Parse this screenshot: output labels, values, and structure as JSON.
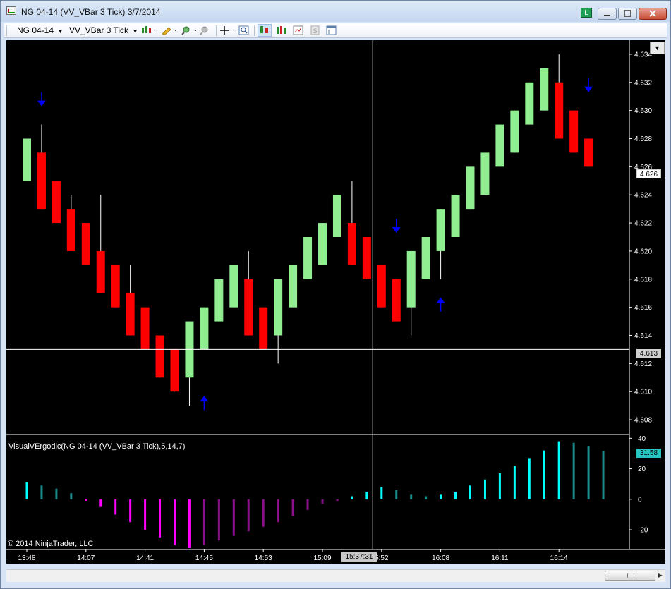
{
  "window": {
    "title": "NG 04-14 (VV_VBar 3 Tick)  3/7/2014",
    "lock_label": "L",
    "minimize_icon": "minimize-icon",
    "maximize_icon": "maximize-icon",
    "close_icon": "close-icon"
  },
  "toolbar": {
    "instrument": "NG 04-14",
    "bar_type": "VV_VBar 3 Tick",
    "icons": [
      "candlestick-style-icon",
      "pencil-draw-icon",
      "zoom-in-icon",
      "zoom-out-icon",
      "crosshair-icon",
      "magnifier-icon",
      "strategy-icon",
      "indicator-icon",
      "properties-icon",
      "dollar-icon",
      "data-box-icon"
    ]
  },
  "chart": {
    "dropdown_icon": "chevron-down-icon",
    "indicator_label": "VisualVErgodic(NG 04-14 (VV_VBar 3 Tick),5,14,7)",
    "copyright": "© 2014 NinjaTrader, LLC",
    "last_price_tag": "4.626",
    "crosshair_price_tag": "4.613",
    "indicator_value_tag": "31.58",
    "crosshair_time_tag": "15:37:31",
    "colors": {
      "background": "#000000",
      "up": "#90ee90",
      "down": "#ff0000",
      "arrow": "#0000ff",
      "ind_pos": "#00ffff",
      "ind_neg": "#ff00ff"
    }
  },
  "chart_data": [
    {
      "type": "candlestick",
      "title": "",
      "ylim": [
        4.607,
        4.635
      ],
      "y_ticks": [
        4.608,
        4.61,
        4.612,
        4.614,
        4.616,
        4.618,
        4.62,
        4.622,
        4.624,
        4.626,
        4.628,
        4.63,
        4.632,
        4.634
      ],
      "x_ticks": [
        "13:48",
        "14:07",
        "14:41",
        "14:45",
        "14:53",
        "15:09",
        "5:52",
        "16:08",
        "16:11",
        "16:14"
      ],
      "x_tick_bar_index": [
        0,
        4,
        8,
        12,
        16,
        20,
        24,
        28,
        32,
        36
      ],
      "bars": [
        {
          "open": 4.625,
          "high": 4.628,
          "low": 4.625,
          "close": 4.628
        },
        {
          "open": 4.627,
          "high": 4.629,
          "low": 4.623,
          "close": 4.623
        },
        {
          "open": 4.625,
          "high": 4.625,
          "low": 4.622,
          "close": 4.622
        },
        {
          "open": 4.623,
          "high": 4.624,
          "low": 4.62,
          "close": 4.62
        },
        {
          "open": 4.622,
          "high": 4.622,
          "low": 4.619,
          "close": 4.619
        },
        {
          "open": 4.62,
          "high": 4.624,
          "low": 4.617,
          "close": 4.617
        },
        {
          "open": 4.619,
          "high": 4.619,
          "low": 4.616,
          "close": 4.616
        },
        {
          "open": 4.617,
          "high": 4.619,
          "low": 4.614,
          "close": 4.614
        },
        {
          "open": 4.616,
          "high": 4.616,
          "low": 4.613,
          "close": 4.613
        },
        {
          "open": 4.614,
          "high": 4.614,
          "low": 4.611,
          "close": 4.611
        },
        {
          "open": 4.613,
          "high": 4.613,
          "low": 4.61,
          "close": 4.61
        },
        {
          "open": 4.611,
          "high": 4.615,
          "low": 4.609,
          "close": 4.615
        },
        {
          "open": 4.613,
          "high": 4.616,
          "low": 4.613,
          "close": 4.616
        },
        {
          "open": 4.615,
          "high": 4.618,
          "low": 4.615,
          "close": 4.618
        },
        {
          "open": 4.616,
          "high": 4.619,
          "low": 4.616,
          "close": 4.619
        },
        {
          "open": 4.618,
          "high": 4.62,
          "low": 4.614,
          "close": 4.614
        },
        {
          "open": 4.616,
          "high": 4.616,
          "low": 4.613,
          "close": 4.613
        },
        {
          "open": 4.614,
          "high": 4.618,
          "low": 4.612,
          "close": 4.618
        },
        {
          "open": 4.616,
          "high": 4.619,
          "low": 4.616,
          "close": 4.619
        },
        {
          "open": 4.618,
          "high": 4.621,
          "low": 4.618,
          "close": 4.621
        },
        {
          "open": 4.619,
          "high": 4.622,
          "low": 4.619,
          "close": 4.622
        },
        {
          "open": 4.621,
          "high": 4.624,
          "low": 4.621,
          "close": 4.624
        },
        {
          "open": 4.622,
          "high": 4.625,
          "low": 4.619,
          "close": 4.619
        },
        {
          "open": 4.621,
          "high": 4.621,
          "low": 4.618,
          "close": 4.618
        },
        {
          "open": 4.619,
          "high": 4.619,
          "low": 4.616,
          "close": 4.616
        },
        {
          "open": 4.618,
          "high": 4.618,
          "low": 4.615,
          "close": 4.615
        },
        {
          "open": 4.616,
          "high": 4.62,
          "low": 4.614,
          "close": 4.62
        },
        {
          "open": 4.618,
          "high": 4.621,
          "low": 4.618,
          "close": 4.621
        },
        {
          "open": 4.62,
          "high": 4.623,
          "low": 4.618,
          "close": 4.623
        },
        {
          "open": 4.621,
          "high": 4.624,
          "low": 4.621,
          "close": 4.624
        },
        {
          "open": 4.623,
          "high": 4.626,
          "low": 4.623,
          "close": 4.626
        },
        {
          "open": 4.624,
          "high": 4.627,
          "low": 4.624,
          "close": 4.627
        },
        {
          "open": 4.626,
          "high": 4.629,
          "low": 4.626,
          "close": 4.629
        },
        {
          "open": 4.627,
          "high": 4.63,
          "low": 4.627,
          "close": 4.63
        },
        {
          "open": 4.629,
          "high": 4.632,
          "low": 4.629,
          "close": 4.632
        },
        {
          "open": 4.63,
          "high": 4.633,
          "low": 4.63,
          "close": 4.633
        },
        {
          "open": 4.632,
          "high": 4.634,
          "low": 4.628,
          "close": 4.628
        },
        {
          "open": 4.63,
          "high": 4.63,
          "low": 4.627,
          "close": 4.627
        },
        {
          "open": 4.628,
          "high": 4.628,
          "low": 4.626,
          "close": 4.626
        }
      ],
      "signals": [
        {
          "bar": 1,
          "direction": "down",
          "price": 4.6305
        },
        {
          "bar": 12,
          "direction": "up",
          "price": 4.6095
        },
        {
          "bar": 25,
          "direction": "down",
          "price": 4.6215
        },
        {
          "bar": 28,
          "direction": "up",
          "price": 4.6165
        },
        {
          "bar": 38,
          "direction": "down",
          "price": 4.6315
        }
      ],
      "crosshair": {
        "price": 4.613,
        "bar": 23.4
      }
    },
    {
      "type": "bar",
      "title": "VisualVErgodic(NG 04-14 (VV_VBar 3 Tick),5,14,7)",
      "ylim": [
        -32,
        42
      ],
      "y_ticks": [
        40,
        20,
        0,
        -20
      ],
      "values": [
        11,
        9,
        7,
        4,
        -1,
        -5,
        -10,
        -15,
        -20,
        -25,
        -30,
        -32,
        -30,
        -27,
        -24,
        -21,
        -18,
        -15,
        -11,
        -7,
        -3,
        -1,
        2,
        5,
        8,
        6,
        3,
        2,
        3,
        5,
        9,
        13,
        17,
        22,
        27,
        32,
        38,
        37,
        35,
        31.58
      ]
    }
  ]
}
